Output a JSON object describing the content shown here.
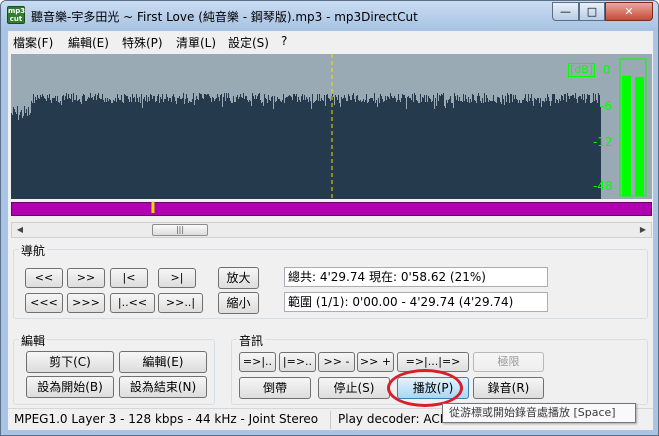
{
  "window": {
    "title": "聽音樂-宇多田光 ~ First Love (純音樂 - 鋼琴版).mp3 - mp3DirectCut",
    "app_icon_text": "mp3 cut",
    "minimize": "—",
    "maximize": "□",
    "close": "✕"
  },
  "menu": [
    "檔案(F)",
    "編輯(E)",
    "特殊(P)",
    "清單(L)",
    "設定(S)",
    "?"
  ],
  "meter": {
    "unit": "[dB]",
    "labels": [
      "0",
      "-6",
      "-12",
      "-48"
    ],
    "left_level": 0.94,
    "right_level": 0.93,
    "color": "#00ff00"
  },
  "colors": {
    "waveform": "#253a4d",
    "waveform_bg": "#9aaab4",
    "position_bar": "#b000b0",
    "cursor_line": "#f0e000"
  },
  "scrollbar": {
    "left_arrow": "◀",
    "right_arrow": "▶",
    "thumb_grip": "|||"
  },
  "nav": {
    "label": "導航",
    "row1": [
      "<<",
      ">>",
      "|<",
      ">|"
    ],
    "row2": [
      "<<<",
      ">>>",
      "|..<<",
      ">>..|"
    ],
    "zoom_in": "放大",
    "zoom_out": "縮小",
    "total_info": "總共: 4'29.74  現在: 0'58.62  (21%)",
    "range_info": "範圍 (1/1): 0'00.00 - 4'29.74 (4'29.74)"
  },
  "edit": {
    "label": "編輯",
    "cut": "剪下(C)",
    "edit": "編輯(E)",
    "set_start": "設為開始(B)",
    "set_end": "設為結束(N)"
  },
  "audio": {
    "label": "音訊",
    "row1": [
      "=>|..",
      "|=>..",
      ">> -",
      ">> +",
      "=>|...|=>",
      "極限"
    ],
    "rewind": "倒帶",
    "stop": "停止(S)",
    "play": "播放(P)",
    "record": "錄音(R)"
  },
  "status": {
    "format": "MPEG1.0 Layer 3 - 128 kbps - 44 kHz - Joint Stereo",
    "decoder": "Play decoder: ACM"
  },
  "tooltip": "從游標或開始錄音處播放  [Space]"
}
